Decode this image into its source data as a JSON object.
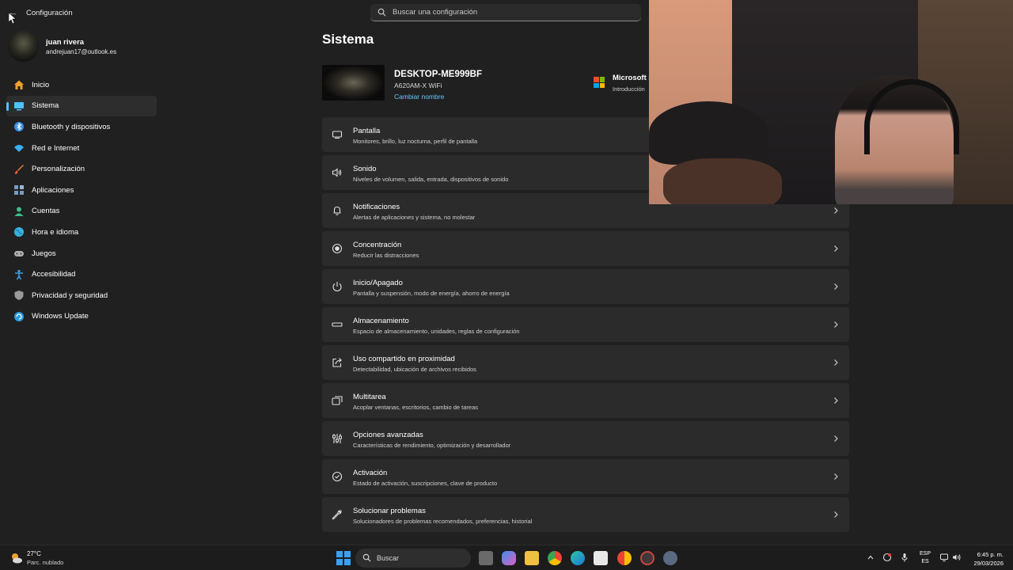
{
  "window": {
    "title": "Configuración"
  },
  "search": {
    "placeholder": "Buscar una configuración"
  },
  "user": {
    "name": "juan rivera",
    "email": "andrejuan17@outlook.es"
  },
  "sidebar": {
    "items": [
      {
        "label": "Inicio",
        "icon": "home-icon",
        "color": "#f0a030"
      },
      {
        "label": "Sistema",
        "icon": "system-icon",
        "color": "#4cc2ff",
        "selected": true
      },
      {
        "label": "Bluetooth y dispositivos",
        "icon": "bluetooth-icon",
        "color": "#3a8ee6"
      },
      {
        "label": "Red e Internet",
        "icon": "wifi-icon",
        "color": "#3ab0f0"
      },
      {
        "label": "Personalización",
        "icon": "brush-icon",
        "color": "#e8803a"
      },
      {
        "label": "Aplicaciones",
        "icon": "apps-icon",
        "color": "#7a9ac0"
      },
      {
        "label": "Cuentas",
        "icon": "person-icon",
        "color": "#3ac08a"
      },
      {
        "label": "Hora e idioma",
        "icon": "globe-icon",
        "color": "#3ab0e0"
      },
      {
        "label": "Juegos",
        "icon": "gamepad-icon",
        "color": "#b0b0b0"
      },
      {
        "label": "Accesibilidad",
        "icon": "accessibility-icon",
        "color": "#3aa0e8"
      },
      {
        "label": "Privacidad y seguridad",
        "icon": "shield-icon",
        "color": "#9a9a9a"
      },
      {
        "label": "Windows Update",
        "icon": "update-icon",
        "color": "#2e9be0"
      }
    ]
  },
  "main": {
    "title": "Sistema",
    "device": {
      "name": "DESKTOP-ME999BF",
      "model": "A620AM-X WiFi",
      "rename": "Cambiar nombre"
    },
    "promo": {
      "title": "Microsoft 365",
      "subtitle": "Introducción"
    },
    "settings": [
      {
        "title": "Pantalla",
        "subtitle": "Monitores, brillo, luz nocturna, perfil de pantalla",
        "icon": "monitor-icon"
      },
      {
        "title": "Sonido",
        "subtitle": "Niveles de volumen, salida, entrada, dispositivos de sonido",
        "icon": "speaker-icon"
      },
      {
        "title": "Notificaciones",
        "subtitle": "Alertas de aplicaciones y sistema, no molestar",
        "icon": "bell-icon"
      },
      {
        "title": "Concentración",
        "subtitle": "Reducir las distracciones",
        "icon": "focus-icon"
      },
      {
        "title": "Inicio/Apagado",
        "subtitle": "Pantalla y suspensión, modo de energía, ahorro de energía",
        "icon": "power-icon"
      },
      {
        "title": "Almacenamiento",
        "subtitle": "Espacio de almacenamiento, unidades, reglas de configuración",
        "icon": "storage-icon"
      },
      {
        "title": "Uso compartido en proximidad",
        "subtitle": "Detectabilidad, ubicación de archivos recibidos",
        "icon": "share-icon"
      },
      {
        "title": "Multitarea",
        "subtitle": "Acoplar ventanas, escritorios, cambio de tareas",
        "icon": "multitask-icon"
      },
      {
        "title": "Opciones avanzadas",
        "subtitle": "Características de rendimiento, optimización y desarrollador",
        "icon": "sliders-icon"
      },
      {
        "title": "Activación",
        "subtitle": "Estado de activación, suscripciones, clave de producto",
        "icon": "check-circle-icon"
      },
      {
        "title": "Solucionar problemas",
        "subtitle": "Solucionadores de problemas recomendados, preferencias, historial",
        "icon": "wrench-icon"
      }
    ]
  },
  "taskbar": {
    "weather": {
      "temp": "27°C",
      "desc": "Parc. nublado"
    },
    "search_label": "Buscar",
    "lang_top": "ESP",
    "lang_bottom": "ES",
    "time": "6:45 p. m.",
    "date": "29/03/2026"
  },
  "accent": "#4cc2ff"
}
